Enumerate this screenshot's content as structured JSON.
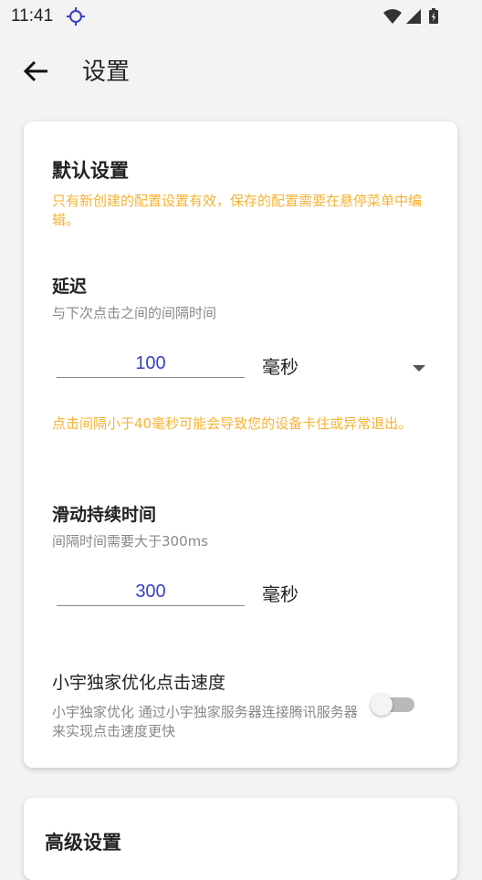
{
  "status": {
    "time": "11:41"
  },
  "header": {
    "title": "设置"
  },
  "default_settings": {
    "title": "默认设置",
    "note": "只有新创建的配置设置有效，保存的配置需要在悬停菜单中编辑。",
    "delay": {
      "title": "延迟",
      "desc": "与下次点击之间的间隔时间",
      "value": "100",
      "unit": "毫秒",
      "warning": "点击间隔小于40毫秒可能会导致您的设备卡住或异常退出。"
    },
    "swipe": {
      "title": "滑动持续时间",
      "desc": "间隔时间需要大于300ms",
      "value": "300",
      "unit": "毫秒"
    },
    "optimize": {
      "title": "小宇独家优化点击速度",
      "desc": "小宇独家优化  通过小宇独家服务器连接腾讯服务器来实现点击速度更快",
      "enabled": false
    }
  },
  "advanced_settings": {
    "title": "高级设置"
  },
  "colors": {
    "accent": "#3a3fc4",
    "warning": "#f5b335"
  }
}
